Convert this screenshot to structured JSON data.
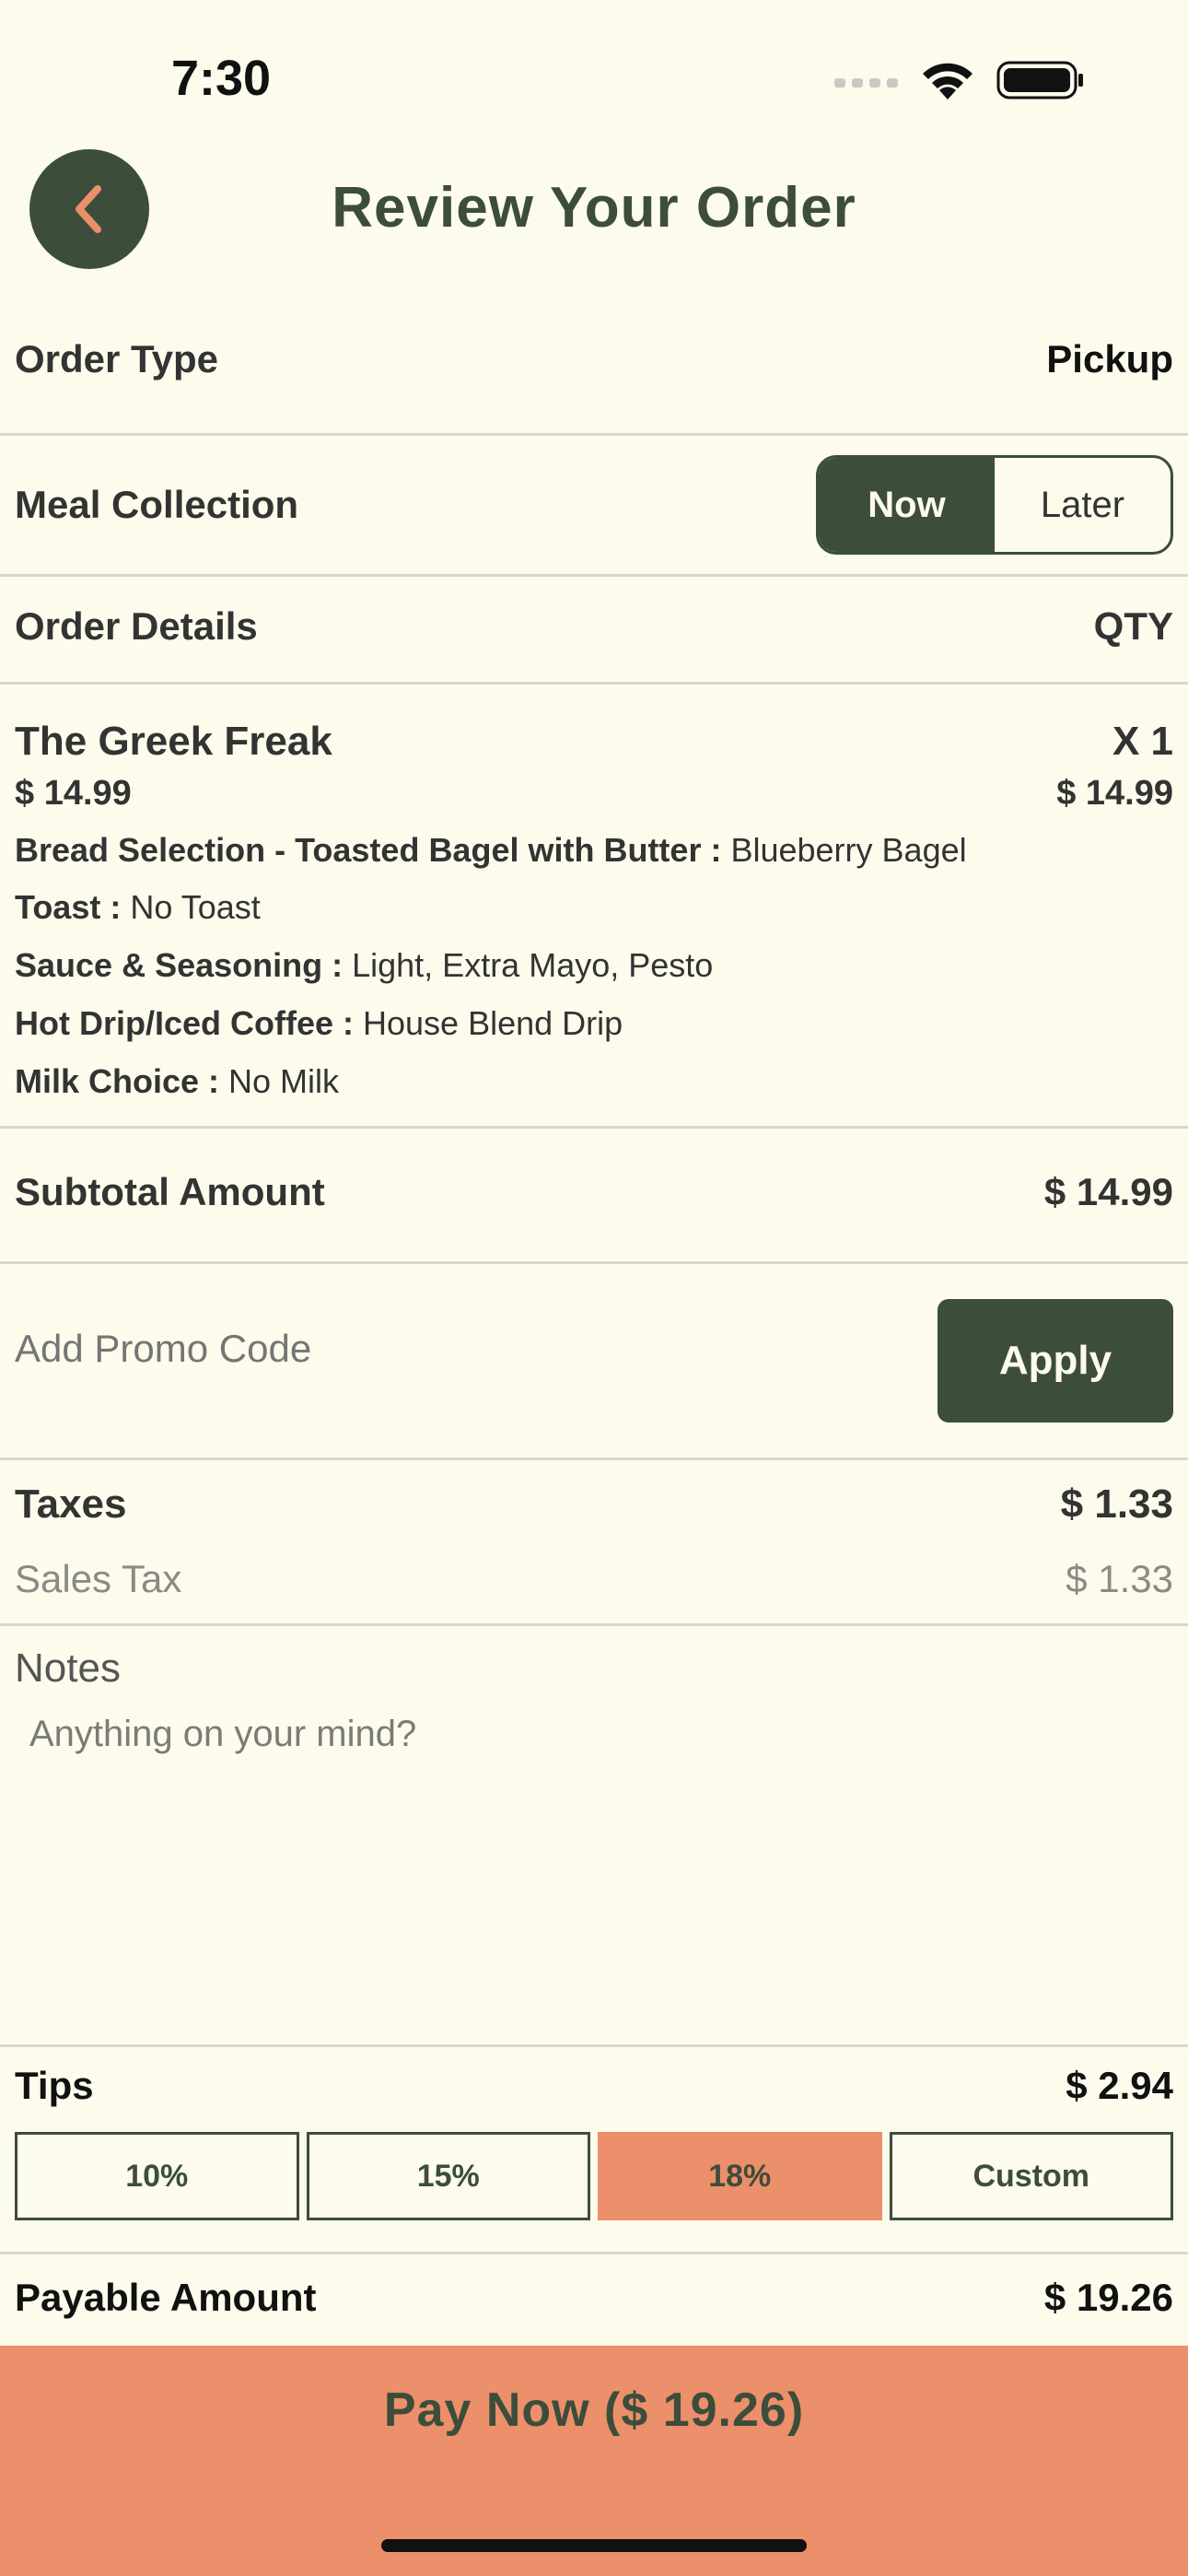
{
  "status": {
    "time": "7:30"
  },
  "header": {
    "title": "Review Your Order"
  },
  "order_type": {
    "label": "Order Type",
    "value": "Pickup"
  },
  "meal_collection": {
    "label": "Meal Collection",
    "options": [
      "Now",
      "Later"
    ],
    "selected": "Now"
  },
  "order_details": {
    "label": "Order Details",
    "qty_label": "QTY"
  },
  "item": {
    "name": "The Greek Freak",
    "qty": "X 1",
    "unit_price": "$ 14.99",
    "line_total": "$ 14.99",
    "modifiers": [
      {
        "key": "Bread Selection - Toasted Bagel with Butter :",
        "value": " Blueberry Bagel"
      },
      {
        "key": "Toast :",
        "value": " No Toast"
      },
      {
        "key": "Sauce & Seasoning :",
        "value": " Light, Extra Mayo, Pesto"
      },
      {
        "key": "Hot Drip/Iced Coffee :",
        "value": " House Blend Drip"
      },
      {
        "key": "Milk Choice :",
        "value": " No Milk"
      }
    ]
  },
  "subtotal": {
    "label": "Subtotal Amount",
    "value": "$ 14.99"
  },
  "promo": {
    "placeholder": "Add Promo Code",
    "apply_label": "Apply"
  },
  "taxes": {
    "label": "Taxes",
    "value": "$ 1.33",
    "sales_tax_label": "Sales Tax",
    "sales_tax_value": "$ 1.33"
  },
  "notes": {
    "label": "Notes",
    "placeholder": "Anything on your mind?"
  },
  "tips": {
    "label": "Tips",
    "value": "$ 2.94",
    "options": [
      "10%",
      "15%",
      "18%",
      "Custom"
    ],
    "selected": "18%"
  },
  "payable": {
    "label": "Payable Amount",
    "value": "$ 19.26"
  },
  "pay_button": {
    "label": "Pay Now ($ 19.26)"
  },
  "colors": {
    "primary": "#3c4d3b",
    "accent": "#ec8f6b",
    "background": "#fdfbec"
  }
}
